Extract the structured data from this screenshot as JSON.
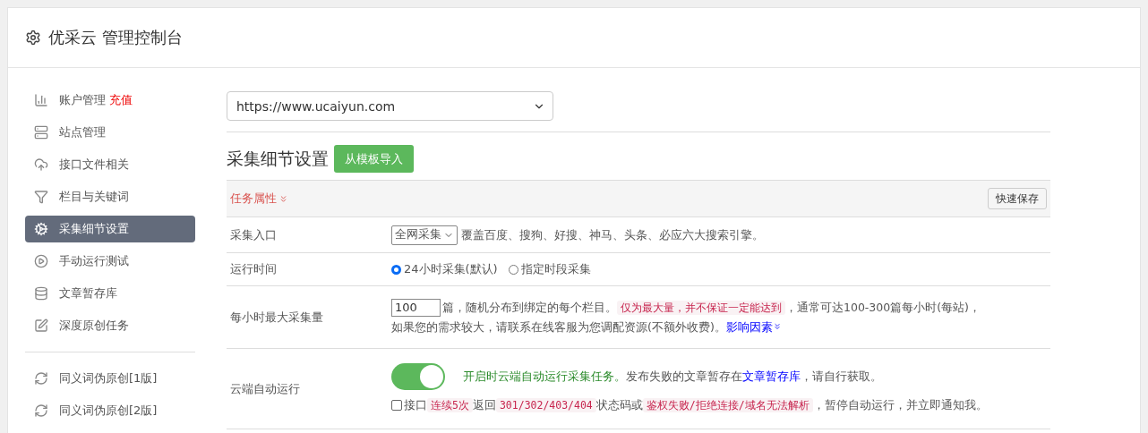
{
  "header": {
    "title": "优采云 管理控制台"
  },
  "sidebar": {
    "groups": [
      [
        {
          "label": "账户管理",
          "badge": "充值",
          "selected": false
        },
        {
          "label": "站点管理",
          "selected": false
        },
        {
          "label": "接口文件相关",
          "selected": false
        },
        {
          "label": "栏目与关键词",
          "selected": false
        },
        {
          "label": "采集细节设置",
          "selected": true
        },
        {
          "label": "手动运行测试",
          "selected": false
        },
        {
          "label": "文章暂存库",
          "selected": false
        },
        {
          "label": "深度原创任务",
          "selected": false
        }
      ],
      [
        {
          "label": "同义词伪原创[1版]",
          "selected": false
        },
        {
          "label": "同义词伪原创[2版]",
          "selected": false
        }
      ]
    ]
  },
  "site_select": {
    "value": "https://www.ucaiyun.com"
  },
  "section": {
    "title": "采集细节设置",
    "import_button": "从模板导入"
  },
  "form": {
    "header": {
      "label": "任务属性",
      "save_button": "快速保存"
    },
    "rows": [
      {
        "kind": "select",
        "label": "采集入口",
        "value": "全网采集",
        "note": "覆盖百度、搜狗、好搜、神马、头条、必应六大搜索引擎。"
      },
      {
        "kind": "radio",
        "label": "运行时间",
        "options": [
          {
            "label": "24小时采集(默认)",
            "selected": true
          },
          {
            "label": "指定时段采集",
            "selected": false
          }
        ]
      },
      {
        "kind": "number",
        "label": "每小时最大采集量",
        "value": "100",
        "lines": [
          [
            {
              "kind": "text",
              "text": "篇，随机分布到绑定的每个栏目。"
            },
            {
              "kind": "code",
              "text": "仅为最大量，并不保证一定能达到"
            },
            {
              "kind": "text",
              "text": "，通常可达100-300篇每小时(每站)，"
            }
          ],
          [
            {
              "kind": "text",
              "text": "如果您的需求较大，请联系在线客服为您调配资源(不额外收费)。"
            },
            {
              "kind": "link",
              "text": "影响因素"
            }
          ]
        ]
      },
      {
        "kind": "toggle",
        "label": "云端自动运行",
        "on": true,
        "line": [
          {
            "kind": "green",
            "text": "开启时云端自动运行采集任务。"
          },
          {
            "kind": "text",
            "text": "发布失败的文章暂存在"
          },
          {
            "kind": "link",
            "text": "文章暂存库"
          },
          {
            "kind": "text",
            "text": "，请自行获取。"
          }
        ],
        "checkbox": {
          "checked": false,
          "line": [
            {
              "kind": "text",
              "text": "接口"
            },
            {
              "kind": "code",
              "text": "连续5次"
            },
            {
              "kind": "text",
              "text": "返回"
            },
            {
              "kind": "code",
              "text": "301/302/403/404"
            },
            {
              "kind": "text",
              "text": "状态码或"
            },
            {
              "kind": "code",
              "text": "鉴权失败/拒绝连接/域名无法解析"
            },
            {
              "kind": "text",
              "text": "，暂停自动运行，并立即通知我。"
            }
          ]
        }
      }
    ]
  }
}
